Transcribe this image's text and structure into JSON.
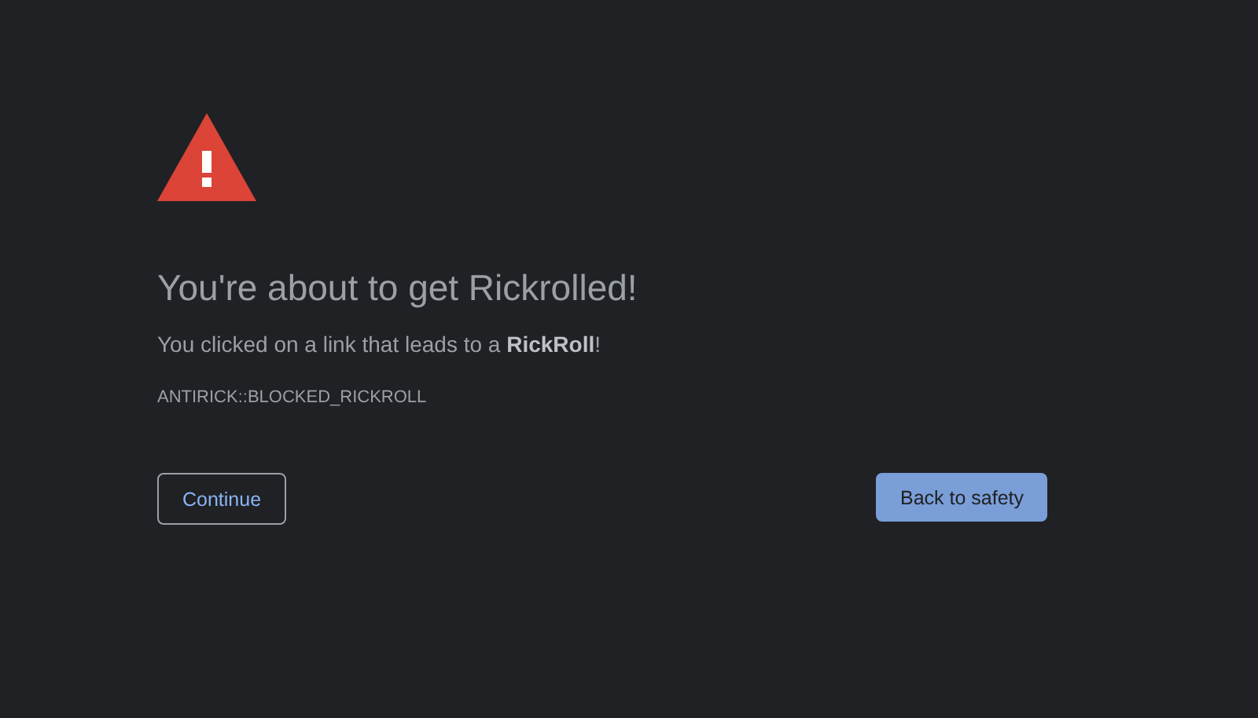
{
  "heading": "You're about to get Rickrolled!",
  "message": "You clicked on a link that leads to a **RickRoll**!",
  "error_code": "ANTIRICK::BLOCKED_RICKROLL",
  "buttons": [
    {
      "label": "Continue",
      "kind": "secondary"
    },
    {
      "label": "Back to safety",
      "kind": "primary"
    }
  ]
}
